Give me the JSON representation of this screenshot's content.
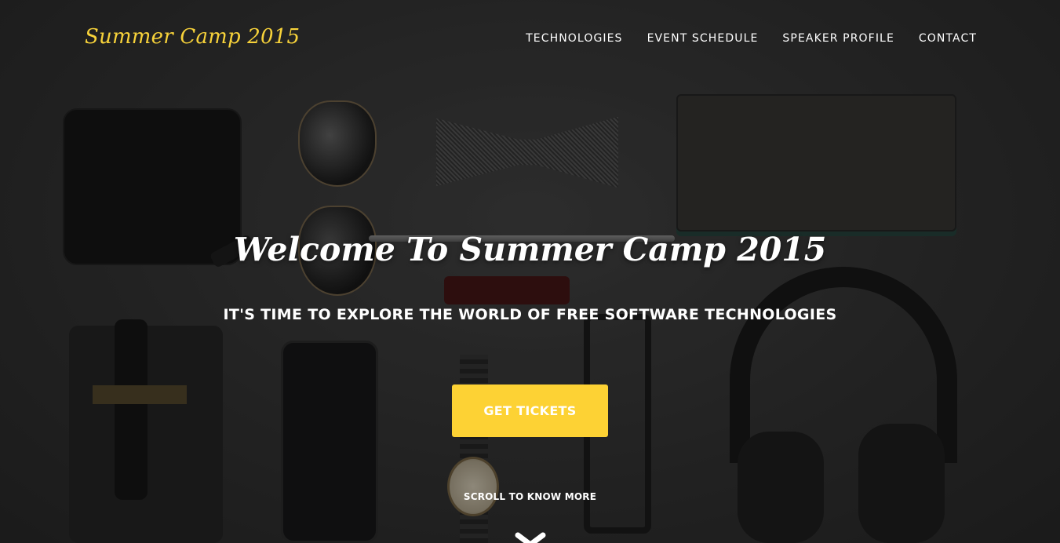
{
  "brand": {
    "logo_text": "Summer Camp 2015",
    "accent": "#fdd234"
  },
  "nav": {
    "items": [
      {
        "label": "TECHNOLOGIES"
      },
      {
        "label": "EVENT SCHEDULE"
      },
      {
        "label": "SPEAKER PROFILE"
      },
      {
        "label": "CONTACT"
      }
    ]
  },
  "hero": {
    "title": "Welcome To Summer Camp 2015",
    "subtitle": "IT'S TIME TO EXPLORE THE WORLD OF FREE SOFTWARE TECHNOLOGIES",
    "cta_label": "GET TICKETS",
    "scroll_text": "SCROLL TO KNOW MORE",
    "scroll_icon": "chevron-down-icon"
  }
}
